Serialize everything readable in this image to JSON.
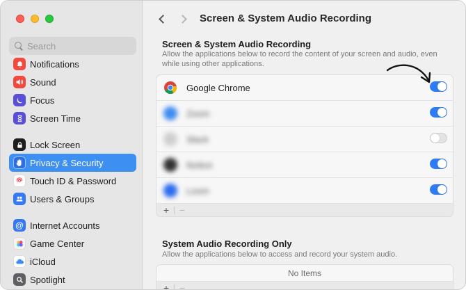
{
  "sidebar": {
    "search_placeholder": "Search",
    "groups": [
      [
        {
          "label": "Notifications",
          "icon": "bell-icon",
          "color": "#f4483d",
          "glyph": "🔔"
        },
        {
          "label": "Sound",
          "icon": "speaker-icon",
          "color": "#f4483d",
          "glyph": "🔊"
        },
        {
          "label": "Focus",
          "icon": "moon-icon",
          "color": "#5a50d8",
          "glyph": "☾"
        },
        {
          "label": "Screen Time",
          "icon": "hourglass-icon",
          "color": "#5a50d8",
          "glyph": "⌛"
        }
      ],
      [
        {
          "label": "Lock Screen",
          "icon": "lock-icon",
          "color": "#1e1e1e",
          "glyph": "🔒"
        },
        {
          "label": "Privacy & Security",
          "icon": "hand-icon",
          "color": "#2e6fe0",
          "glyph": "✋",
          "active": true
        },
        {
          "label": "Touch ID & Password",
          "icon": "fingerprint-icon",
          "color": "#ffffff",
          "glyph": "◎"
        },
        {
          "label": "Users & Groups",
          "icon": "users-icon",
          "color": "#3478f6",
          "glyph": "👥"
        }
      ],
      [
        {
          "label": "Internet Accounts",
          "icon": "at-icon",
          "color": "#3478f6",
          "glyph": "@"
        },
        {
          "label": "Game Center",
          "icon": "game-center-icon",
          "color": "#f4f4f4",
          "glyph": "●"
        },
        {
          "label": "iCloud",
          "icon": "cloud-icon",
          "color": "#ffffff",
          "glyph": "☁"
        },
        {
          "label": "Spotlight",
          "icon": "spotlight-icon",
          "color": "#5f6063",
          "glyph": "🔍"
        }
      ]
    ]
  },
  "header": {
    "title": "Screen & System Audio Recording"
  },
  "section1": {
    "title": "Screen & System Audio Recording",
    "description": "Allow the applications below to record the content of your screen and audio, even while using other applications.",
    "apps": [
      {
        "name": "Google Chrome",
        "icon": "chrome-icon",
        "enabled": true,
        "blurred": false
      },
      {
        "name": "Zoom",
        "icon": "app-icon",
        "enabled": true,
        "blurred": true
      },
      {
        "name": "Slack",
        "icon": "app-icon",
        "enabled": false,
        "blurred": true
      },
      {
        "name": "Notion",
        "icon": "app-icon",
        "enabled": true,
        "blurred": true
      },
      {
        "name": "Loom",
        "icon": "app-icon",
        "enabled": true,
        "blurred": true
      }
    ],
    "add_label": "+",
    "remove_label": "−"
  },
  "section2": {
    "title": "System Audio Recording Only",
    "description": "Allow the applications below to access and record your system audio.",
    "empty_label": "No Items",
    "add_label": "+",
    "remove_label": "−"
  }
}
